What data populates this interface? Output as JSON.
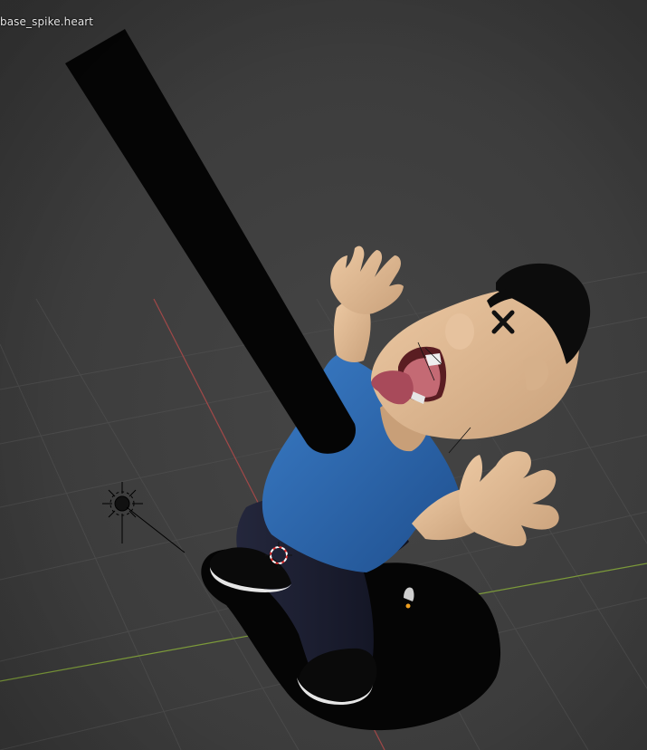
{
  "viewport": {
    "active_object_label": "base_spike.heart",
    "background": "#3d3d3d",
    "grid_line_color": "#4a4a4a",
    "x_axis_color": "#a04848",
    "y_axis_color": "#7c9a3a"
  },
  "scene": {
    "objects": [
      {
        "name": "spike",
        "color": "#050505"
      },
      {
        "name": "character",
        "skin": "#e1bc96",
        "shirt": "#2a66ad",
        "pants": "#15172a",
        "hair": "#0c0c0c",
        "shoes": "#0a0a0a",
        "soles": "#e6e6e6"
      },
      {
        "name": "base",
        "color": "#050505"
      }
    ],
    "gizmos": [
      "light-gizmo",
      "3d-cursor",
      "origin-point"
    ]
  }
}
